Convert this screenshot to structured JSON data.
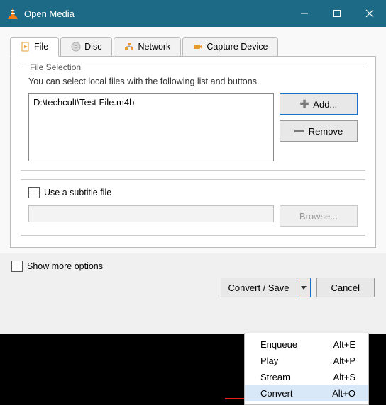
{
  "title": "Open Media",
  "tabs": {
    "file": "File",
    "disc": "Disc",
    "network": "Network",
    "capture": "Capture Device"
  },
  "file_selection": {
    "legend": "File Selection",
    "hint": "You can select local files with the following list and buttons.",
    "file0": "D:\\techcult\\Test File.m4b",
    "add": "Add...",
    "remove": "Remove"
  },
  "subtitle": {
    "label": "Use a subtitle file",
    "browse": "Browse..."
  },
  "footer": {
    "show_more": "Show more options",
    "convert_save": "Convert / Save",
    "cancel": "Cancel"
  },
  "menu": {
    "enqueue": {
      "label": "Enqueue",
      "accel": "Alt+E"
    },
    "play": {
      "label": "Play",
      "accel": "Alt+P"
    },
    "stream": {
      "label": "Stream",
      "accel": "Alt+S"
    },
    "convert": {
      "label": "Convert",
      "accel": "Alt+O"
    }
  }
}
